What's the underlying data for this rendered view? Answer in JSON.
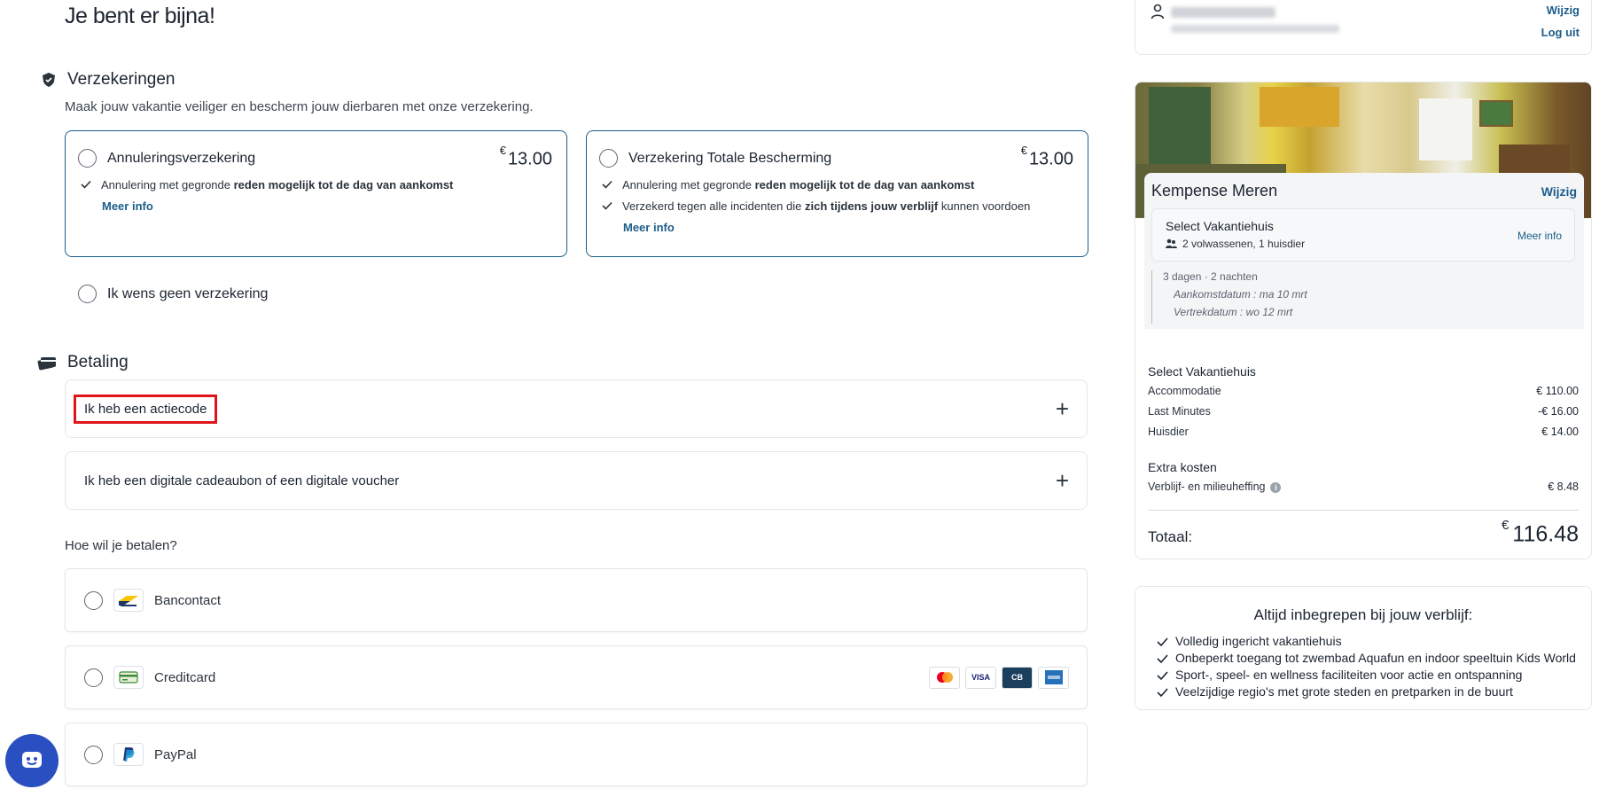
{
  "page": {
    "title": "Je bent er bijna!"
  },
  "insurance": {
    "heading": "Verzekeringen",
    "subtitle": "Maak jouw vakantie veiliger en bescherm jouw dierbaren met onze verzekering.",
    "options": [
      {
        "title": "Annuleringsverzekering",
        "currency": "€",
        "price": "13.00",
        "features": [
          {
            "pre": "Annulering met gegronde ",
            "bold": "reden mogelijk tot de dag van aankomst",
            "post": ""
          }
        ],
        "more": "Meer info"
      },
      {
        "title": "Verzekering Totale Bescherming",
        "currency": "€",
        "price": "13.00",
        "features": [
          {
            "pre": "Annulering met gegronde ",
            "bold": "reden mogelijk tot de dag van aankomst",
            "post": ""
          },
          {
            "pre": "Verzekerd tegen alle incidenten die ",
            "bold": "zich tijdens jouw verblijf",
            "post": " kunnen voordoen"
          }
        ],
        "more": "Meer info"
      }
    ],
    "none_label": "Ik wens geen verzekering"
  },
  "payment": {
    "heading": "Betaling",
    "promo_label": "Ik heb een actiecode",
    "voucher_label": "Ik heb een digitale cadeaubon of een digitale voucher",
    "question": "Hoe wil je betalen?",
    "methods": [
      {
        "label": "Bancontact",
        "icon": "bancontact-logo-icon"
      },
      {
        "label": "Creditcard",
        "icon": "creditcard-icon"
      },
      {
        "label": "PayPal",
        "icon": "paypal-logo-icon"
      }
    ],
    "card_brands": [
      "mastercard",
      "VISA",
      "CB",
      "amex"
    ]
  },
  "account": {
    "edit": "Wijzig",
    "logout": "Log uit"
  },
  "summary": {
    "park": "Kempense Meren",
    "edit": "Wijzig",
    "house": "Select Vakantiehuis",
    "guests": "2 volwassenen, 1 huisdier",
    "more": "Meer info",
    "stay": "3 dagen · 2 nachten",
    "arrival": "Aankomstdatum : ma 10 mrt",
    "departure": "Vertrekdatum : wo 12 mrt",
    "cost_section_1": "Select Vakantiehuis",
    "lines_1": [
      {
        "label": "Accommodatie",
        "value": "€ 110.00"
      },
      {
        "label": "Last Minutes",
        "value": "-€ 16.00"
      },
      {
        "label": "Huisdier",
        "value": "€ 14.00"
      }
    ],
    "cost_section_2": "Extra kosten",
    "lines_2": [
      {
        "label": "Verblijf- en milieuheffing",
        "value": "€ 8.48"
      }
    ],
    "total_label": "Totaal:",
    "total_currency": "€",
    "total_value": "116.48"
  },
  "included": {
    "title": "Altijd inbegrepen bij jouw verblijf:",
    "items": [
      "Volledig ingericht vakantiehuis",
      "Onbeperkt toegang tot zwembad Aquafun en indoor speeltuin Kids World",
      "Sport-, speel- en wellness faciliteiten voor actie en ontspanning",
      "Veelzijdige regio's met grote steden en pretparken in de buurt"
    ]
  },
  "colors": {
    "accent": "#1c5d8a",
    "highlight": "#e0151c",
    "chat": "#2a4fc0"
  }
}
